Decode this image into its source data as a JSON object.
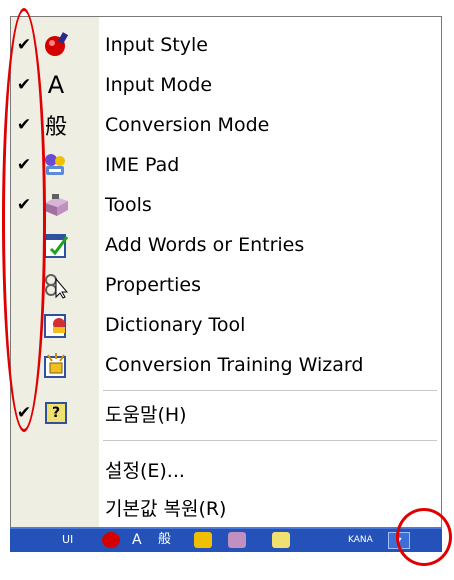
{
  "menu": {
    "items": [
      {
        "label": "Input Style",
        "checked": true,
        "icon": "input-style-icon"
      },
      {
        "label": "Input Mode",
        "checked": true,
        "icon": "input-mode-icon"
      },
      {
        "label": "Conversion Mode",
        "checked": true,
        "icon": "conversion-mode-icon"
      },
      {
        "label": "IME Pad",
        "checked": true,
        "icon": "ime-pad-icon"
      },
      {
        "label": "Tools",
        "checked": true,
        "icon": "tools-icon"
      },
      {
        "label": "Add Words or Entries",
        "checked": false,
        "icon": "add-words-icon"
      },
      {
        "label": "Properties",
        "checked": false,
        "icon": "properties-icon"
      },
      {
        "label": "Dictionary Tool",
        "checked": false,
        "icon": "dictionary-tool-icon"
      },
      {
        "label": "Conversion Training Wizard",
        "checked": false,
        "icon": "training-wizard-icon"
      },
      {
        "label": "도움말(H)",
        "checked": true,
        "icon": "help-icon"
      },
      {
        "label": "설정(E)...",
        "checked": false,
        "icon": ""
      },
      {
        "label": "기본값 복원(R)",
        "checked": false,
        "icon": ""
      }
    ],
    "check_glyph": "✔",
    "input_mode_glyph": "A",
    "conversion_mode_glyph": "般",
    "help_glyph": "?"
  },
  "taskbar": {
    "left_text": "UI",
    "mode_text": "KANA",
    "dropdown_glyph": "▾",
    "color": "#2452b8"
  },
  "annotations": {
    "color": "#e00000"
  }
}
